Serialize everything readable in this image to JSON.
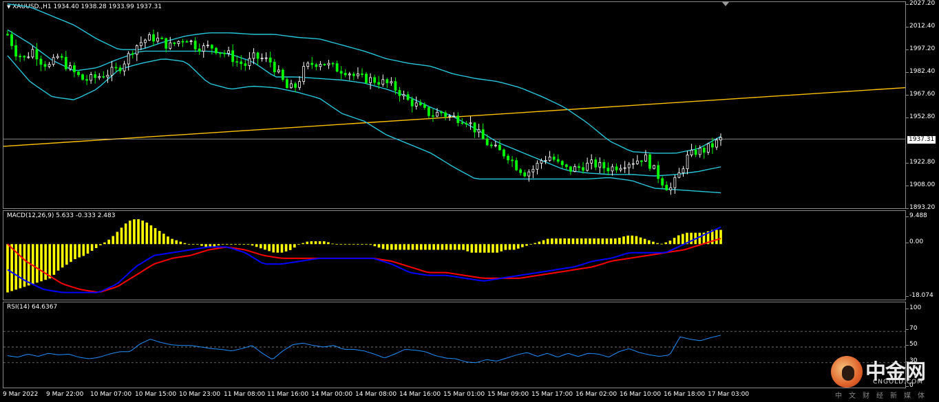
{
  "symbol_header": {
    "caret": "▼",
    "text": "XAUUSD.,H1  1934.40 1938.28 1933.99 1937.31"
  },
  "price_scale": [
    "2027.20",
    "2012.40",
    "1997.20",
    "1982.40",
    "1967.60",
    "1952.80",
    "1922.80",
    "1908.00",
    "1893.20"
  ],
  "current_price": "1937.31",
  "macd": {
    "label": "MACD(12,26,9) 5.633 -0.333 2.483",
    "scale": [
      "9.488",
      "0.00",
      "-18.074"
    ]
  },
  "rsi": {
    "label": "RSI(14) 64.6367",
    "scale": [
      "100",
      "70",
      "50",
      "30",
      "0"
    ]
  },
  "time_axis": [
    "9 Mar 2022",
    "9 Mar 22:00",
    "10 Mar 07:00",
    "10 Mar 15:00",
    "10 Mar 23:00",
    "11 Mar 08:00",
    "11 Mar 16:00",
    "14 Mar 00:00",
    "14 Mar 08:00",
    "14 Mar 16:00",
    "15 Mar 01:00",
    "15 Mar 09:00",
    "15 Mar 17:00",
    "16 Mar 02:00",
    "16 Mar 10:00",
    "16 Mar 18:00",
    "17 Mar 03:00"
  ],
  "watermark": {
    "name_cn": "中金网",
    "name_en": "CNGOLD.COM",
    "subtitle": "中文财经新媒体"
  },
  "colors": {
    "bullish": "#ffffff",
    "bearish": "#00ff00",
    "bollinger": "#26c6da",
    "trendline": "#ffc107",
    "macd_hist": "#ffff00",
    "macd_line": "#0000ff",
    "signal_line": "#ff0000",
    "rsi_line": "#1e90ff"
  },
  "chart_data": [
    {
      "type": "candlestick",
      "title": "XAUUSD.,H1",
      "ylim": [
        1890.0,
        2030.0
      ],
      "indicators": [
        "Bollinger Bands",
        "trend line",
        "horizontal line at 1937.31"
      ],
      "close_path": [
        2006,
        1994,
        1990,
        1996,
        1988,
        1985,
        1992,
        1985,
        1980,
        1976,
        1977,
        1979,
        1981,
        1983,
        1990,
        1998,
        2002,
        2004,
        2002,
        1998,
        2001,
        2004,
        1999,
        1997,
        1998,
        1995,
        1993,
        1988,
        1986,
        1991,
        1990,
        1988,
        1979,
        1970,
        1972,
        1984,
        1987,
        1988,
        1985,
        1983,
        1982,
        1978,
        1977,
        1976,
        1975,
        1973,
        1969,
        1963,
        1960,
        1956,
        1953,
        1955,
        1952,
        1951,
        1950,
        1944,
        1937,
        1932,
        1929,
        1926,
        1919,
        1915,
        1918,
        1924,
        1926,
        1920,
        1917,
        1918,
        1920,
        1921,
        1919,
        1918,
        1920,
        1922,
        1923,
        1926,
        1918,
        1910,
        1904,
        1913,
        1925,
        1929,
        1930,
        1933,
        1937
      ],
      "upper_band_path": [
        2026,
        2024,
        2018,
        2012,
        2003,
        1996,
        1996,
        2001,
        2005,
        2007,
        2007,
        2006,
        2006,
        2004,
        2003,
        1999,
        1995,
        1990,
        1987,
        1985,
        1980,
        1977,
        1975,
        1971,
        1965,
        1958,
        1948,
        1936,
        1929,
        1928,
        1928,
        1931,
        1939
      ],
      "middle_band_path": [
        2009,
        2000,
        1989,
        1982,
        1984,
        1990,
        1995,
        1995,
        1995,
        1995,
        1993,
        1988,
        1978,
        1978,
        1977,
        1976,
        1974,
        1970,
        1965,
        1958,
        1952,
        1944,
        1935,
        1929,
        1923,
        1917,
        1915,
        1914,
        1914,
        1913,
        1914,
        1916,
        1919
      ],
      "lower_band_path": [
        1992,
        1975,
        1965,
        1963,
        1970,
        1983,
        1987,
        1990,
        1988,
        1974,
        1970,
        1972,
        1971,
        1968,
        1964,
        1954,
        1949,
        1940,
        1934,
        1928,
        1919,
        1911,
        1911,
        1911,
        1911,
        1911,
        1911,
        1912,
        1910,
        1905,
        1904,
        1903,
        1902
      ]
    },
    {
      "type": "bar",
      "title": "MACD(12,26,9)",
      "ylim": [
        -18.074,
        9.488
      ],
      "histogram": [
        -17,
        -16,
        -15,
        -14,
        -13,
        -12,
        -9,
        -7,
        -5,
        -4,
        -2,
        0,
        2,
        5,
        8,
        9,
        8,
        6,
        4,
        2,
        1,
        0,
        0,
        -1,
        -1,
        0,
        0,
        0,
        0,
        -1,
        -2,
        -3,
        -3,
        -2,
        0,
        1,
        1,
        1,
        0,
        0,
        0,
        0,
        0,
        -1,
        -2,
        -2,
        -2,
        -2,
        -2,
        -2,
        -2,
        -2,
        -2,
        -2,
        -3,
        -3,
        -3,
        -3,
        -2,
        -2,
        -1,
        0,
        1,
        2,
        2,
        2,
        2,
        2,
        2,
        2,
        2,
        2,
        3,
        3,
        2,
        1,
        0,
        1,
        3,
        4,
        4,
        4,
        5,
        5
      ],
      "macd_path": [
        -9,
        -13,
        -16,
        -17,
        -17,
        -17,
        -14,
        -8,
        -4,
        -3,
        -2,
        -1,
        -1,
        -3,
        -7,
        -7,
        -6,
        -5,
        -5,
        -5,
        -5,
        -7,
        -10,
        -11,
        -11,
        -12,
        -13,
        -12,
        -11,
        -10,
        -9,
        -8,
        -6,
        -5,
        -3,
        -3,
        -3,
        0,
        3,
        6
      ],
      "signal_path": [
        0,
        -6,
        -10,
        -14,
        -16,
        -17,
        -15,
        -11,
        -7,
        -5,
        -4,
        -2,
        -1,
        -2,
        -4,
        -5,
        -5,
        -5,
        -5,
        -5,
        -5,
        -6,
        -8,
        -10,
        -10,
        -11,
        -12,
        -12,
        -12,
        -11,
        -10,
        -9,
        -8,
        -6,
        -5,
        -4,
        -3,
        -2,
        0,
        2
      ]
    },
    {
      "type": "line",
      "title": "RSI(14)",
      "ylim": [
        0,
        100
      ],
      "levels": [
        70,
        50,
        30
      ],
      "values": [
        39,
        37,
        41,
        38,
        42,
        40,
        41,
        37,
        35,
        37,
        41,
        44,
        44,
        54,
        60,
        56,
        53,
        52,
        52,
        50,
        48,
        47,
        45,
        48,
        52,
        42,
        34,
        45,
        53,
        55,
        52,
        50,
        52,
        47,
        47,
        45,
        41,
        36,
        41,
        47,
        46,
        44,
        39,
        36,
        35,
        31,
        30,
        34,
        32,
        36,
        40,
        43,
        38,
        42,
        37,
        42,
        38,
        42,
        41,
        37,
        44,
        48,
        43,
        40,
        38,
        40,
        63,
        60,
        58,
        62,
        65
      ]
    }
  ]
}
